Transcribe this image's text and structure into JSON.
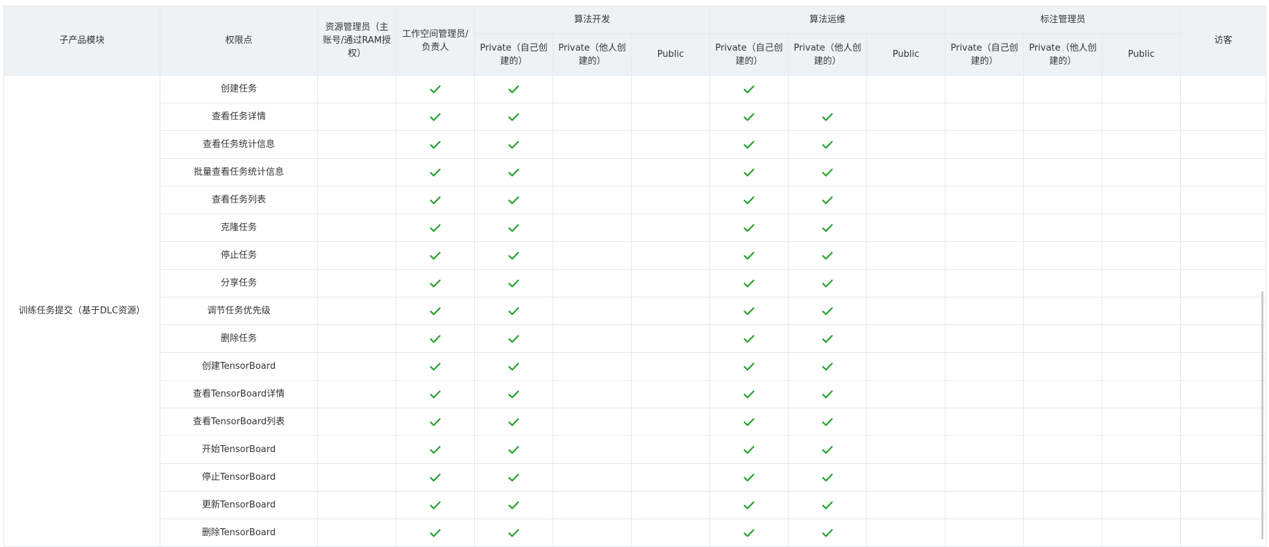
{
  "header": {
    "module": "子产品模块",
    "permission": "权限点",
    "resource_admin": "资源管理员（主账号/通过RAM授权）",
    "workspace_admin": "工作空间管理员/负责人",
    "algo_dev": "算法开发",
    "algo_ops": "算法运维",
    "label_admin": "标注管理员",
    "guest": "访客",
    "private_own": "Private（自己创建的）",
    "private_other": "Private（他人创建的）",
    "public": "Public"
  },
  "module_name": "训练任务提交（基于DLC资源）",
  "columns": [
    "workspace_admin",
    "algo_dev_private_own",
    "algo_dev_private_other",
    "algo_dev_public",
    "algo_ops_private_own",
    "algo_ops_private_other",
    "algo_ops_public",
    "label_private_own",
    "label_private_other",
    "label_public",
    "guest"
  ],
  "check_color": "#23a02a",
  "rows": [
    {
      "name": "创建任务",
      "checks": [
        "workspace_admin",
        "algo_dev_private_own",
        "algo_ops_private_own"
      ]
    },
    {
      "name": "查看任务详情",
      "checks": [
        "workspace_admin",
        "algo_dev_private_own",
        "algo_ops_private_own",
        "algo_ops_private_other"
      ]
    },
    {
      "name": "查看任务统计信息",
      "checks": [
        "workspace_admin",
        "algo_dev_private_own",
        "algo_ops_private_own",
        "algo_ops_private_other"
      ]
    },
    {
      "name": "批量查看任务统计信息",
      "checks": [
        "workspace_admin",
        "algo_dev_private_own",
        "algo_ops_private_own",
        "algo_ops_private_other"
      ]
    },
    {
      "name": "查看任务列表",
      "checks": [
        "workspace_admin",
        "algo_dev_private_own",
        "algo_ops_private_own",
        "algo_ops_private_other"
      ]
    },
    {
      "name": "克隆任务",
      "checks": [
        "workspace_admin",
        "algo_dev_private_own",
        "algo_ops_private_own",
        "algo_ops_private_other"
      ]
    },
    {
      "name": "停止任务",
      "checks": [
        "workspace_admin",
        "algo_dev_private_own",
        "algo_ops_private_own",
        "algo_ops_private_other"
      ]
    },
    {
      "name": "分享任务",
      "checks": [
        "workspace_admin",
        "algo_dev_private_own",
        "algo_ops_private_own",
        "algo_ops_private_other"
      ]
    },
    {
      "name": "调节任务优先级",
      "checks": [
        "workspace_admin",
        "algo_dev_private_own",
        "algo_ops_private_own",
        "algo_ops_private_other"
      ]
    },
    {
      "name": "删除任务",
      "checks": [
        "workspace_admin",
        "algo_dev_private_own",
        "algo_ops_private_own",
        "algo_ops_private_other"
      ]
    },
    {
      "name": "创建TensorBoard",
      "checks": [
        "workspace_admin",
        "algo_dev_private_own",
        "algo_ops_private_own",
        "algo_ops_private_other"
      ]
    },
    {
      "name": "查看TensorBoard详情",
      "checks": [
        "workspace_admin",
        "algo_dev_private_own",
        "algo_ops_private_own",
        "algo_ops_private_other"
      ]
    },
    {
      "name": "查看TensorBoard列表",
      "checks": [
        "workspace_admin",
        "algo_dev_private_own",
        "algo_ops_private_own",
        "algo_ops_private_other"
      ]
    },
    {
      "name": "开始TensorBoard",
      "checks": [
        "workspace_admin",
        "algo_dev_private_own",
        "algo_ops_private_own",
        "algo_ops_private_other"
      ]
    },
    {
      "name": "停止TensorBoard",
      "checks": [
        "workspace_admin",
        "algo_dev_private_own",
        "algo_ops_private_own",
        "algo_ops_private_other"
      ]
    },
    {
      "name": "更新TensorBoard",
      "checks": [
        "workspace_admin",
        "algo_dev_private_own",
        "algo_ops_private_own",
        "algo_ops_private_other"
      ]
    },
    {
      "name": "删除TensorBoard",
      "checks": [
        "workspace_admin",
        "algo_dev_private_own",
        "algo_ops_private_own",
        "algo_ops_private_other"
      ]
    }
  ]
}
